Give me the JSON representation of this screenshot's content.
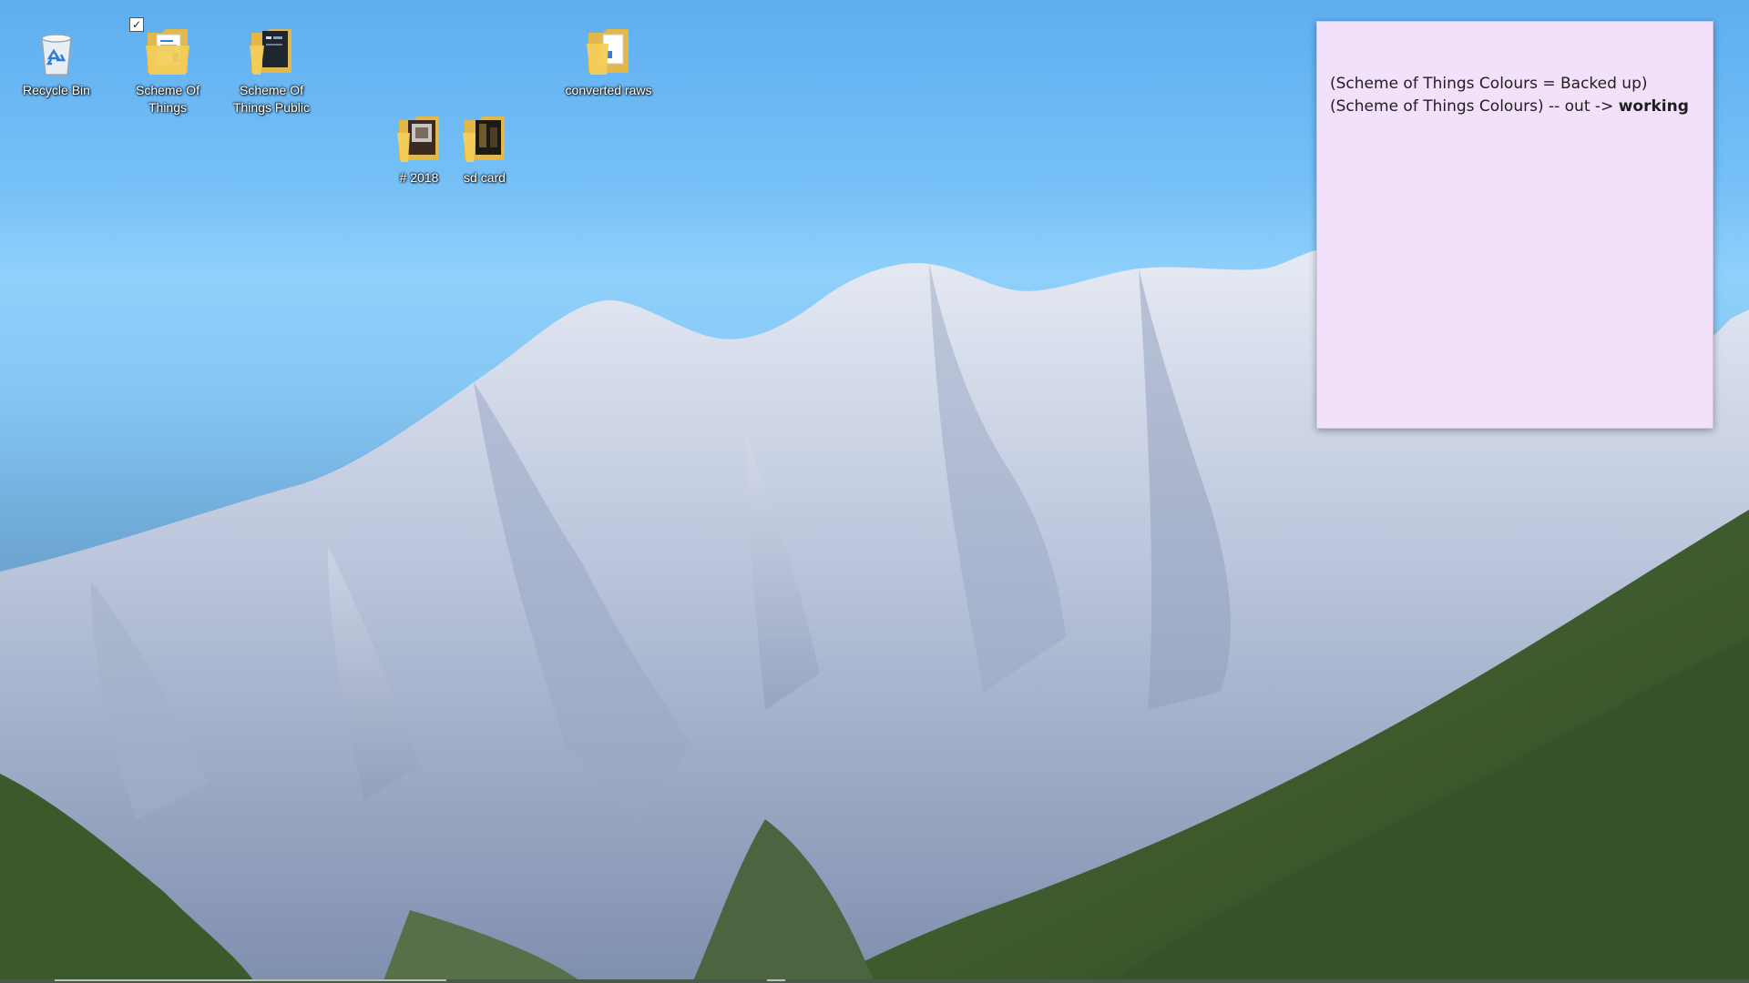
{
  "desktop": {
    "icons": [
      {
        "label": "Recycle Bin",
        "icon": "recycle-bin-icon",
        "selected": false
      },
      {
        "label": "Scheme Of Things",
        "icon": "folder-documents-icon",
        "selected": true
      },
      {
        "label": "Scheme Of Things Public",
        "icon": "folder-dark-icon",
        "selected": false
      },
      {
        "label": "converted raws",
        "icon": "folder-documents-icon",
        "selected": false
      },
      {
        "label": "# 2018",
        "icon": "folder-photo-icon",
        "selected": false
      },
      {
        "label": "sd card",
        "icon": "folder-photo-icon",
        "selected": false
      }
    ]
  },
  "sticky_note": {
    "line1": "(Scheme of Things Colours = Backed up)",
    "line2_prefix": "(Scheme of Things Colours) -- out -> ",
    "line2_bold": "working",
    "color": "#f3e1fb"
  },
  "colors": {
    "sky": "#74bff6",
    "mountain": "#cfd6e6",
    "forest": "#3f5f2e"
  }
}
